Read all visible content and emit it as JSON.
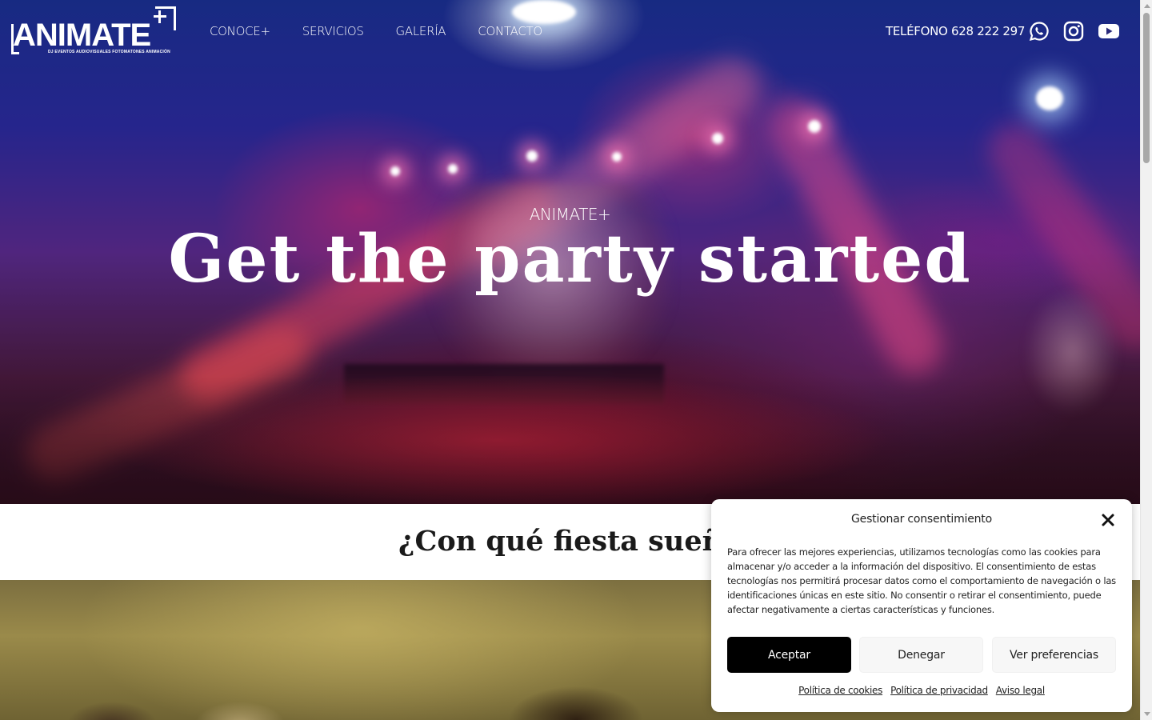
{
  "header": {
    "logo": {
      "text": "ANIMATE",
      "tagline": "DJ  EVENTOS  AUDIOVISUALES  FOTOMATONES  ANIMACIÓN"
    },
    "nav": [
      "CONOCE+",
      "SERVICIOS",
      "GALERÍA",
      "CONTACTO"
    ],
    "phone": "TELÉFONO 628 222 297",
    "social": [
      "whatsapp-icon",
      "instagram-icon",
      "youtube-icon"
    ]
  },
  "hero": {
    "eyebrow": "ANIMATE+",
    "title": "Get the party started"
  },
  "section": {
    "heading": "¿Con qué fiesta sueñas?"
  },
  "consent": {
    "title": "Gestionar consentimiento",
    "body": "Para ofrecer las mejores experiencias, utilizamos tecnologías como las cookies para almacenar y/o acceder a la información del dispositivo. El consentimiento de estas tecnologías nos permitirá procesar datos como el comportamiento de navegación o las identificaciones únicas en este sitio. No consentir o retirar el consentimiento, puede afectar negativamente a ciertas características y funciones.",
    "accept": "Aceptar",
    "deny": "Denegar",
    "preferences": "Ver preferencias",
    "links": [
      "Política de cookies",
      "Política de privacidad",
      "Aviso legal"
    ]
  },
  "colors": {
    "accept_bg": "#000000",
    "button_bg": "#f7f7f7",
    "heading_text": "#1a1a1a"
  }
}
